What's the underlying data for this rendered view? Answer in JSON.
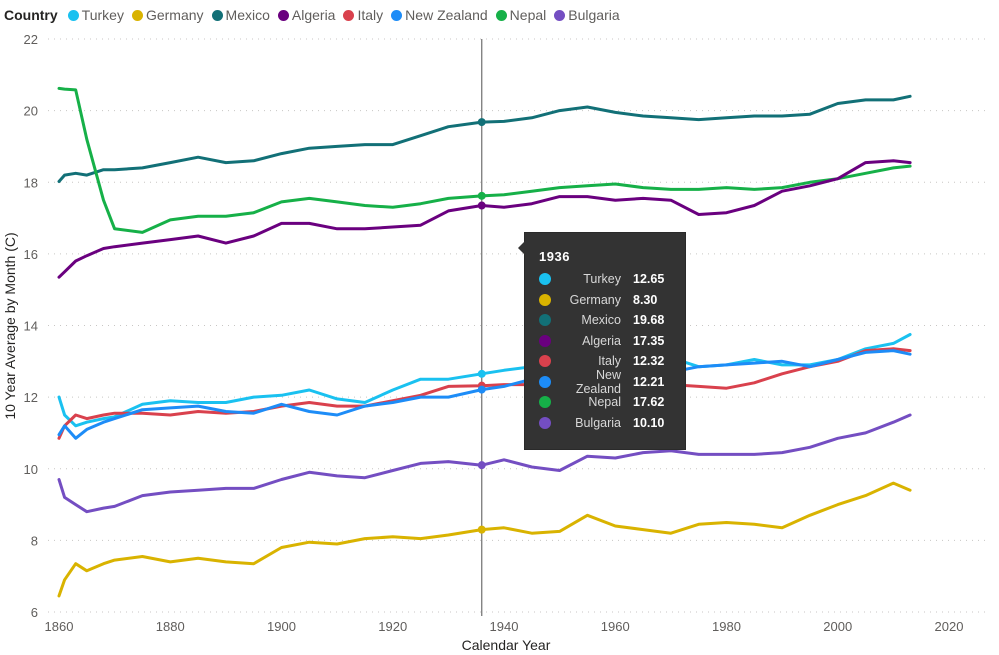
{
  "legend": {
    "title": "Country",
    "items": [
      {
        "name": "Turkey",
        "color": "#1ac1f0"
      },
      {
        "name": "Germany",
        "color": "#d9b300"
      },
      {
        "name": "Mexico",
        "color": "#127077"
      },
      {
        "name": "Algeria",
        "color": "#6a007f"
      },
      {
        "name": "Italy",
        "color": "#d9414d"
      },
      {
        "name": "New Zealand",
        "color": "#1d8cf7"
      },
      {
        "name": "Nepal",
        "color": "#16b048"
      },
      {
        "name": "Bulgaria",
        "color": "#744ec2"
      }
    ]
  },
  "tooltip": {
    "title": "1936",
    "rows": [
      {
        "name": "Turkey",
        "value": "12.65",
        "color": "#1ac1f0"
      },
      {
        "name": "Germany",
        "value": "8.30",
        "color": "#d9b300"
      },
      {
        "name": "Mexico",
        "value": "19.68",
        "color": "#127077"
      },
      {
        "name": "Algeria",
        "value": "17.35",
        "color": "#6a007f"
      },
      {
        "name": "Italy",
        "value": "12.32",
        "color": "#d9414d"
      },
      {
        "name": "New Zealand",
        "value": "12.21",
        "color": "#1d8cf7"
      },
      {
        "name": "Nepal",
        "value": "17.62",
        "color": "#16b048"
      },
      {
        "name": "Bulgaria",
        "value": "10.10",
        "color": "#744ec2"
      }
    ]
  },
  "chart_data": {
    "type": "line",
    "title": "",
    "xlabel": "Calendar Year",
    "ylabel": "10 Year Average by Month (C)",
    "xlim": [
      1858,
      2020
    ],
    "ylim": [
      6,
      22
    ],
    "x_ticks": [
      1860,
      1880,
      1900,
      1920,
      1940,
      1960,
      1980,
      2000,
      2020
    ],
    "y_ticks": [
      6,
      8,
      10,
      12,
      14,
      16,
      18,
      20,
      22
    ],
    "grid": true,
    "legend_position": "top-left",
    "crosshair_x": 1936,
    "x": [
      1860,
      1861,
      1863,
      1865,
      1868,
      1870,
      1875,
      1880,
      1885,
      1890,
      1895,
      1900,
      1905,
      1910,
      1915,
      1920,
      1925,
      1930,
      1936,
      1940,
      1945,
      1950,
      1955,
      1960,
      1965,
      1970,
      1975,
      1980,
      1985,
      1990,
      1995,
      2000,
      2005,
      2010,
      2013
    ],
    "series": [
      {
        "name": "Mexico",
        "color": "#127077",
        "values": [
          18.02,
          18.2,
          18.25,
          18.2,
          18.35,
          18.35,
          18.4,
          18.55,
          18.7,
          18.55,
          18.6,
          18.8,
          18.95,
          19.0,
          19.05,
          19.05,
          19.3,
          19.55,
          19.68,
          19.7,
          19.8,
          20.0,
          20.1,
          19.95,
          19.85,
          19.8,
          19.75,
          19.8,
          19.85,
          19.85,
          19.9,
          20.2,
          20.3,
          20.3,
          20.4
        ]
      },
      {
        "name": "Nepal",
        "color": "#16b048",
        "values": [
          20.62,
          20.6,
          20.58,
          19.2,
          17.5,
          16.7,
          16.6,
          16.95,
          17.05,
          17.05,
          17.15,
          17.45,
          17.55,
          17.45,
          17.35,
          17.3,
          17.4,
          17.55,
          17.62,
          17.65,
          17.75,
          17.85,
          17.9,
          17.95,
          17.85,
          17.8,
          17.8,
          17.85,
          17.8,
          17.85,
          18.0,
          18.1,
          18.25,
          18.4,
          18.45
        ]
      },
      {
        "name": "Algeria",
        "color": "#6a007f",
        "values": [
          15.35,
          15.5,
          15.8,
          15.95,
          16.15,
          16.2,
          16.3,
          16.4,
          16.5,
          16.3,
          16.5,
          16.85,
          16.85,
          16.7,
          16.7,
          16.75,
          16.8,
          17.2,
          17.35,
          17.3,
          17.4,
          17.6,
          17.6,
          17.5,
          17.55,
          17.5,
          17.1,
          17.15,
          17.35,
          17.75,
          17.9,
          18.1,
          18.55,
          18.6,
          18.55
        ]
      },
      {
        "name": "Turkey",
        "color": "#1ac1f0",
        "values": [
          12.0,
          11.5,
          11.2,
          11.3,
          11.4,
          11.45,
          11.8,
          11.9,
          11.85,
          11.85,
          12.0,
          12.05,
          12.2,
          11.95,
          11.85,
          12.2,
          12.5,
          12.5,
          12.65,
          12.75,
          12.85,
          12.9,
          13.0,
          13.0,
          13.05,
          13.1,
          12.85,
          12.9,
          13.05,
          12.9,
          12.9,
          13.05,
          13.35,
          13.5,
          13.75
        ]
      },
      {
        "name": "Italy",
        "color": "#d9414d",
        "values": [
          10.85,
          11.2,
          11.5,
          11.4,
          11.5,
          11.55,
          11.55,
          11.5,
          11.6,
          11.55,
          11.6,
          11.75,
          11.85,
          11.75,
          11.75,
          11.9,
          12.05,
          12.3,
          12.32,
          12.35,
          12.35,
          12.25,
          12.3,
          12.35,
          12.4,
          12.35,
          12.3,
          12.25,
          12.4,
          12.65,
          12.85,
          13.0,
          13.3,
          13.35,
          13.3
        ]
      },
      {
        "name": "New Zealand",
        "color": "#1d8cf7",
        "values": [
          10.95,
          11.2,
          10.85,
          11.1,
          11.3,
          11.4,
          11.65,
          11.7,
          11.75,
          11.6,
          11.55,
          11.8,
          11.6,
          11.5,
          11.75,
          11.85,
          12.0,
          12.0,
          12.21,
          12.3,
          12.5,
          12.6,
          12.7,
          12.75,
          12.8,
          12.7,
          12.85,
          12.9,
          12.95,
          13.0,
          12.85,
          13.05,
          13.25,
          13.3,
          13.2
        ]
      },
      {
        "name": "Bulgaria",
        "color": "#744ec2",
        "values": [
          9.7,
          9.2,
          9.0,
          8.8,
          8.9,
          8.95,
          9.25,
          9.35,
          9.4,
          9.45,
          9.45,
          9.7,
          9.9,
          9.8,
          9.75,
          9.95,
          10.15,
          10.2,
          10.1,
          10.25,
          10.05,
          9.95,
          10.35,
          10.3,
          10.45,
          10.5,
          10.4,
          10.4,
          10.4,
          10.45,
          10.6,
          10.85,
          11.0,
          11.3,
          11.5
        ]
      },
      {
        "name": "Germany",
        "color": "#d9b300",
        "values": [
          6.45,
          6.9,
          7.35,
          7.15,
          7.35,
          7.45,
          7.55,
          7.4,
          7.5,
          7.4,
          7.35,
          7.8,
          7.95,
          7.9,
          8.05,
          8.1,
          8.05,
          8.15,
          8.3,
          8.35,
          8.2,
          8.25,
          8.7,
          8.4,
          8.3,
          8.2,
          8.45,
          8.5,
          8.45,
          8.35,
          8.7,
          9.0,
          9.25,
          9.6,
          9.4
        ]
      }
    ]
  }
}
